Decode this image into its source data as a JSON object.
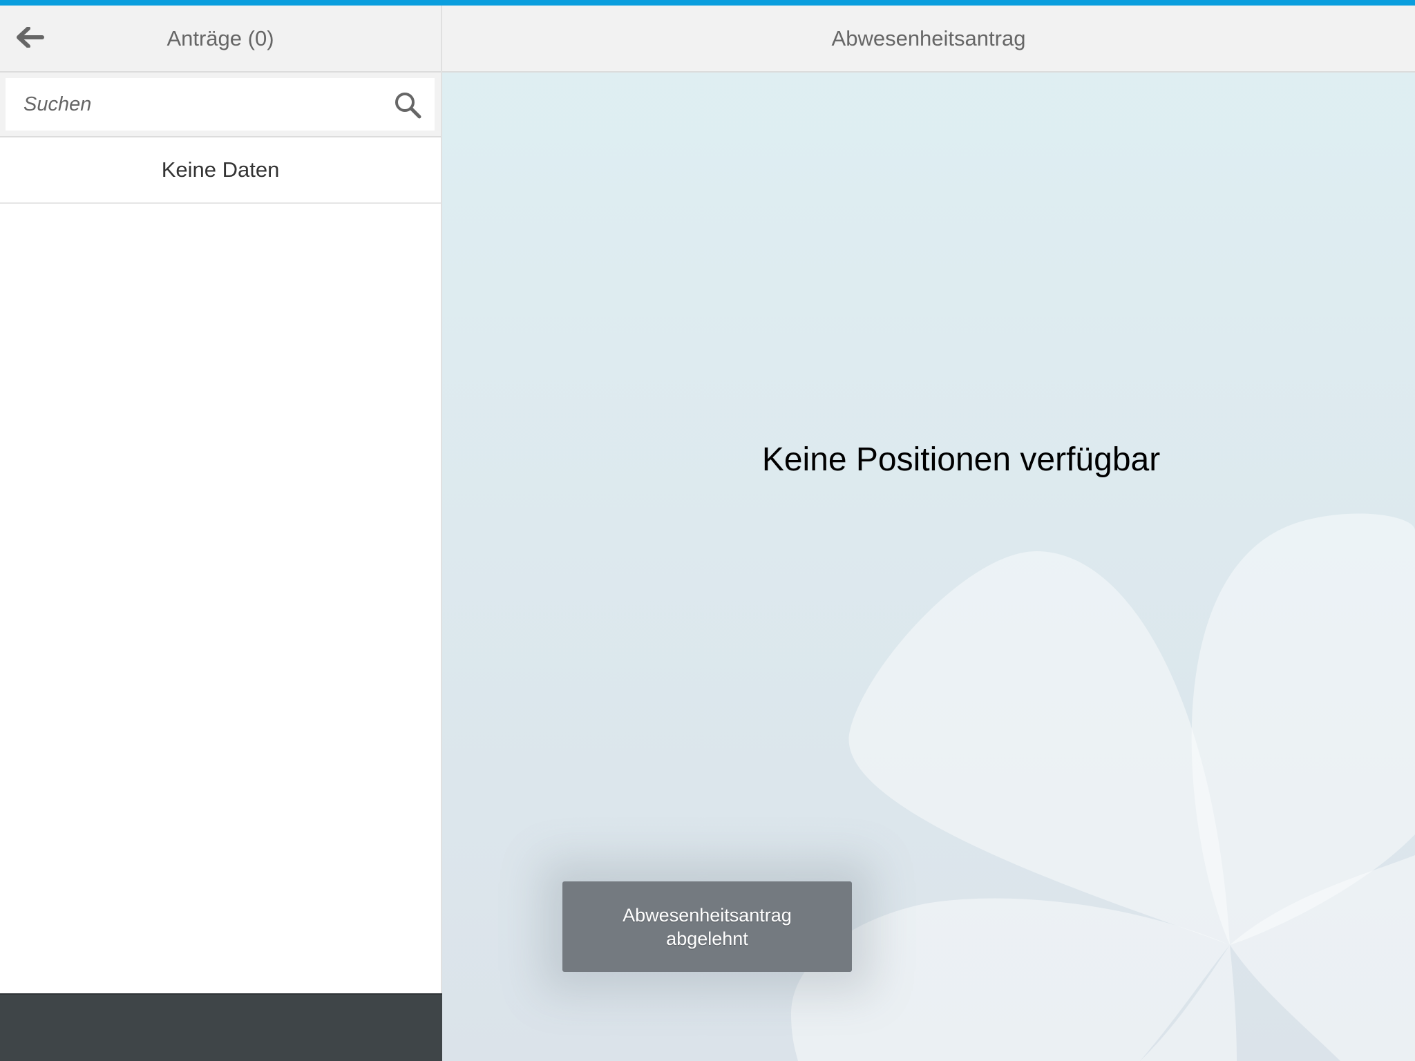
{
  "colors": {
    "accent_bar": "#0a9ede",
    "footer": "#3f4548",
    "toast": "#747a80"
  },
  "master": {
    "title": "Anträge (0)",
    "back_icon": "arrow-left-icon",
    "search": {
      "placeholder": "Suchen",
      "value": "",
      "icon": "search-icon"
    },
    "empty_label": "Keine Daten"
  },
  "detail": {
    "title": "Abwesenheitsantrag",
    "empty_message": "Keine Positionen verfügbar"
  },
  "toast": {
    "line1": "Abwesenheitsantrag",
    "line2": "abgelehnt"
  }
}
